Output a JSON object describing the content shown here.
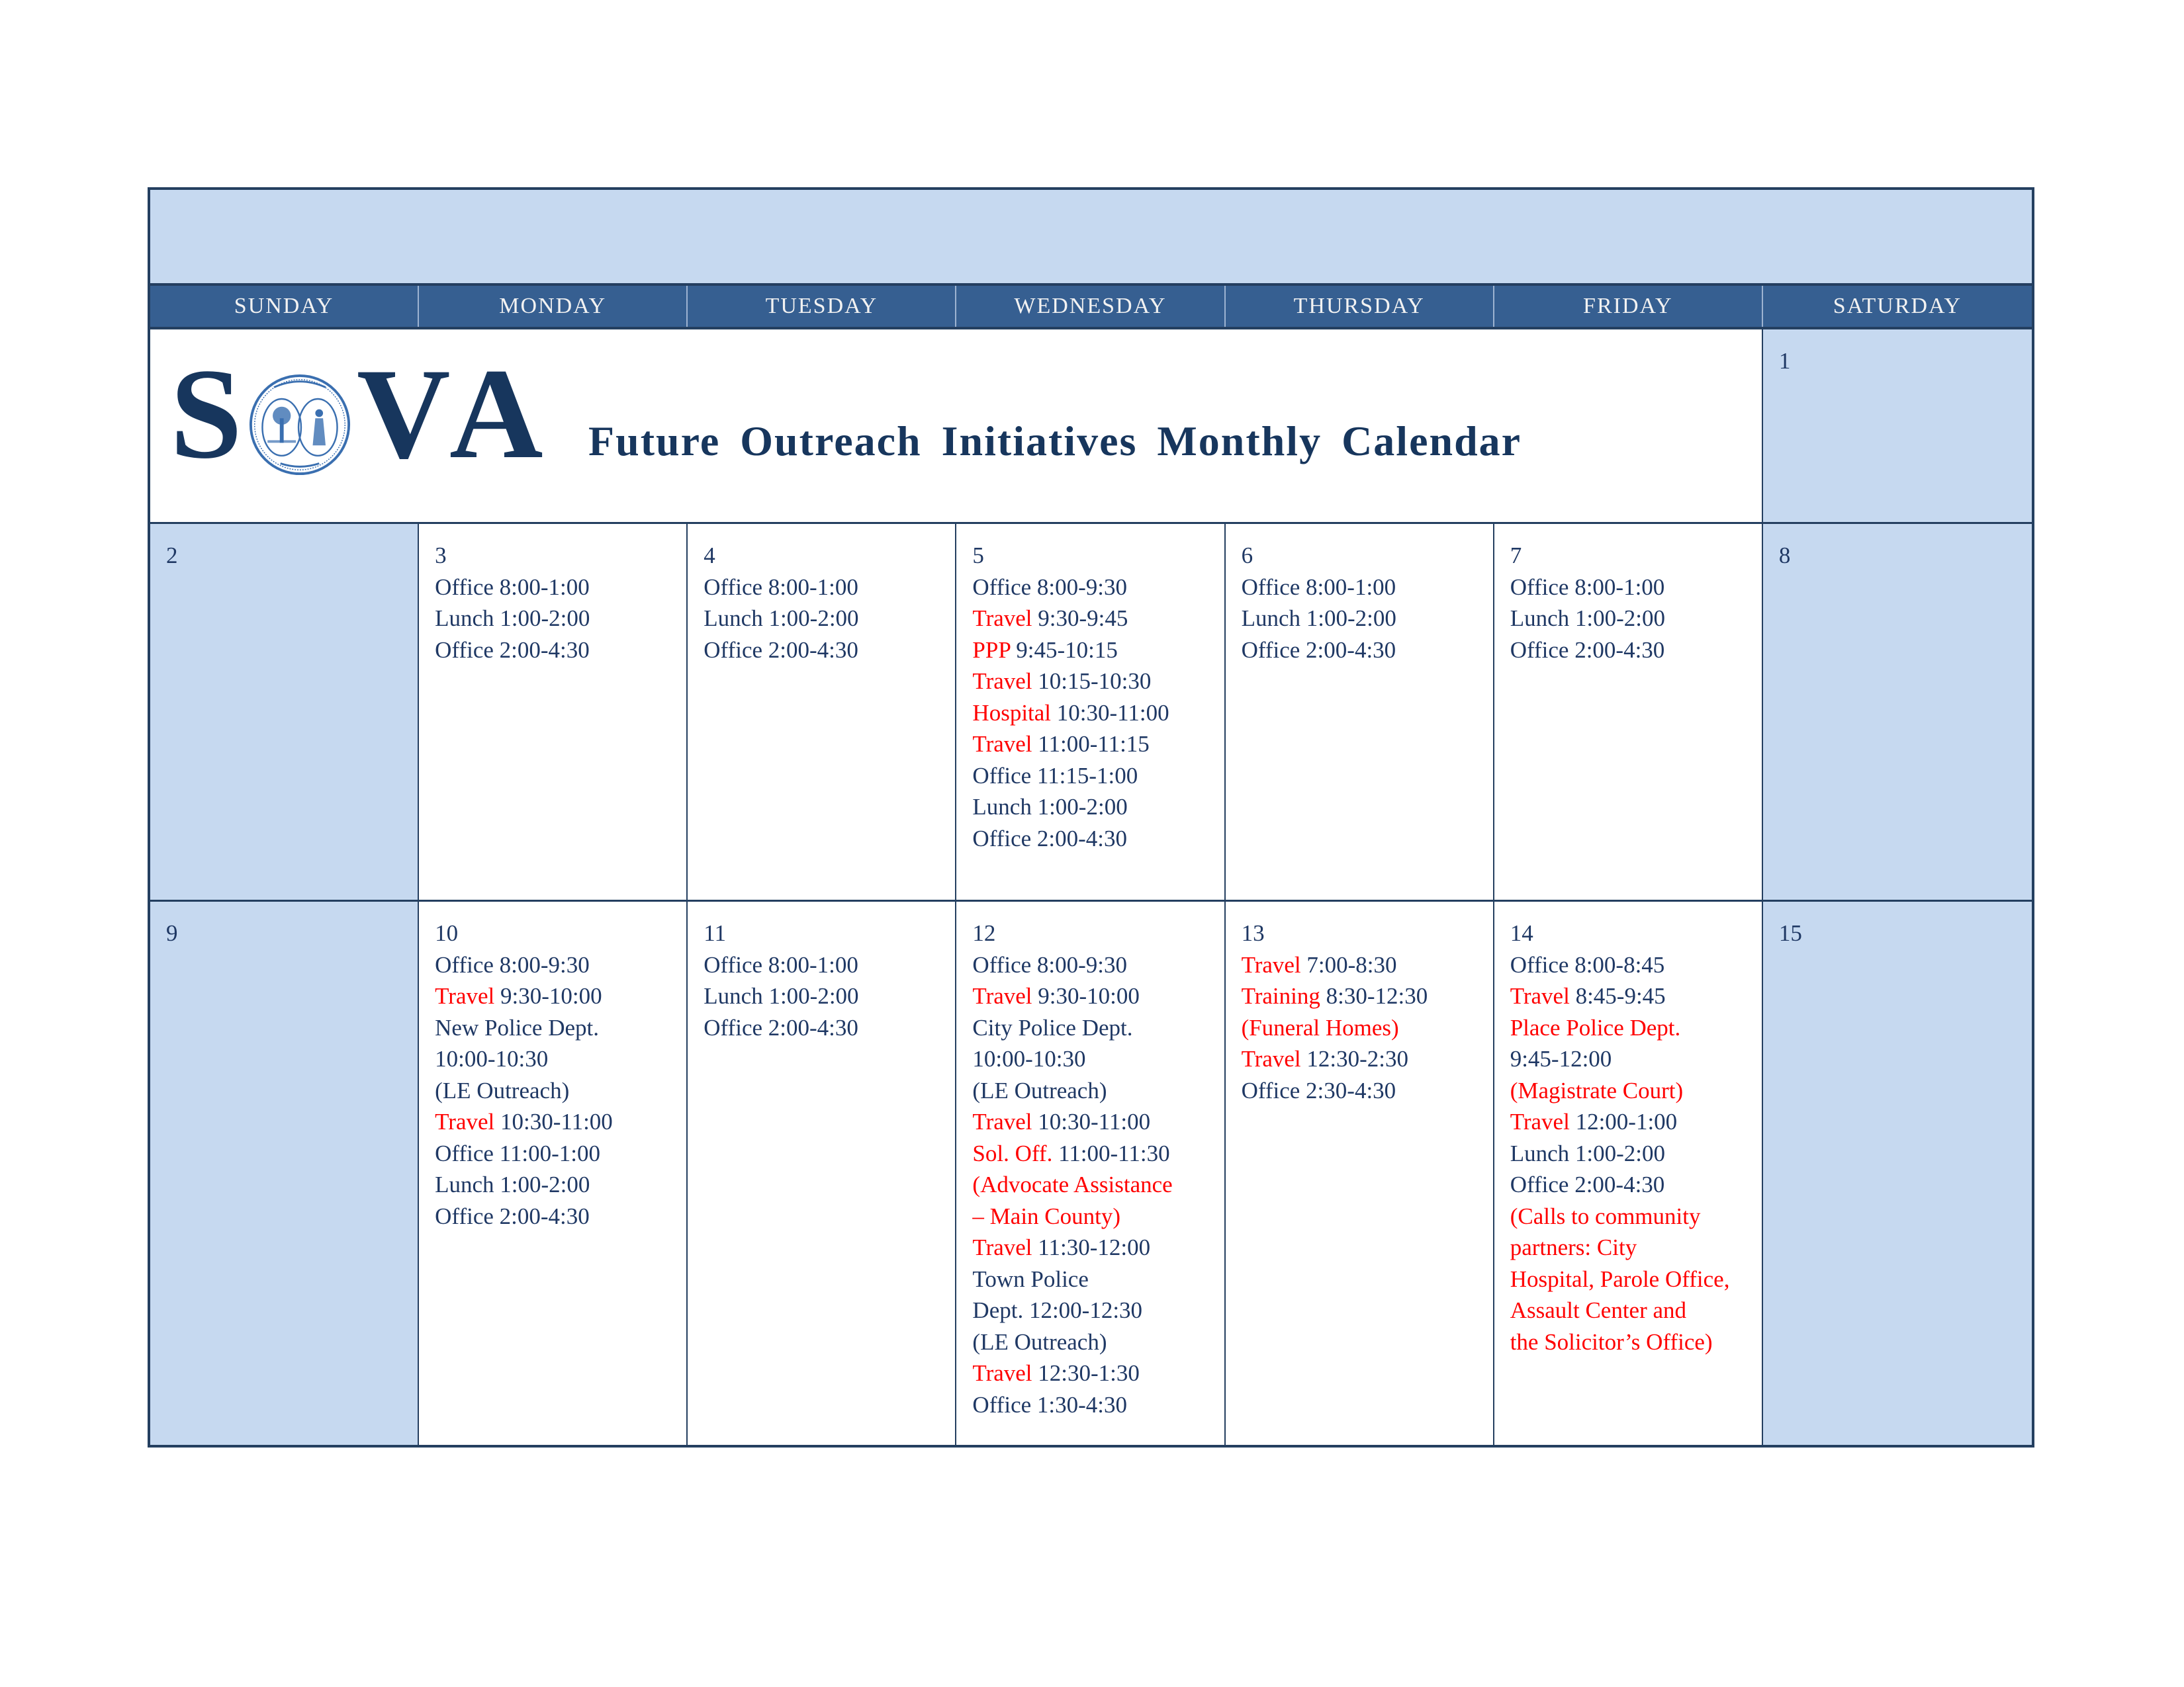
{
  "header": {
    "logo_letters": [
      "S",
      "V",
      "A"
    ],
    "seal_icon": "south-carolina-state-seal",
    "title": "Future Outreach Initiatives Monthly Calendar"
  },
  "weekdays": [
    "SUNDAY",
    "MONDAY",
    "TUESDAY",
    "WEDNESDAY",
    "THURSDAY",
    "FRIDAY",
    "SATURDAY"
  ],
  "colors": {
    "text": "#1f3864",
    "highlight": "#ff0000",
    "weekend_fill": "#c6d9f0",
    "header_fill": "#365f91"
  },
  "weeks": [
    {
      "days": [
        {
          "num": "1",
          "entries": []
        }
      ]
    },
    {
      "days": [
        {
          "num": "2",
          "entries": []
        },
        {
          "num": "3",
          "entries": [
            [
              {
                "t": "Office 8:00-1:00"
              }
            ],
            [
              {
                "t": "Lunch 1:00-2:00"
              }
            ],
            [
              {
                "t": "Office 2:00-4:30"
              }
            ]
          ]
        },
        {
          "num": "4",
          "entries": [
            [
              {
                "t": "Office 8:00-1:00"
              }
            ],
            [
              {
                "t": "Lunch 1:00-2:00"
              }
            ],
            [
              {
                "t": "Office 2:00-4:30"
              }
            ]
          ]
        },
        {
          "num": "5",
          "entries": [
            [
              {
                "t": "Office 8:00-9:30"
              }
            ],
            [
              {
                "t": "Travel",
                "r": true
              },
              {
                "t": " 9:30-9:45"
              }
            ],
            [
              {
                "t": "PPP",
                "r": true
              },
              {
                "t": " 9:45-10:15"
              }
            ],
            [
              {
                "t": "Travel",
                "r": true
              },
              {
                "t": " 10:15-10:30"
              }
            ],
            [
              {
                "t": "Hospital",
                "r": true
              },
              {
                "t": " 10:30-11:00"
              }
            ],
            [
              {
                "t": "Travel",
                "r": true
              },
              {
                "t": " 11:00-11:15"
              }
            ],
            [
              {
                "t": "Office 11:15-1:00"
              }
            ],
            [
              {
                "t": "Lunch 1:00-2:00"
              }
            ],
            [
              {
                "t": "Office 2:00-4:30"
              }
            ]
          ]
        },
        {
          "num": "6",
          "entries": [
            [
              {
                "t": "Office 8:00-1:00"
              }
            ],
            [
              {
                "t": "Lunch 1:00-2:00"
              }
            ],
            [
              {
                "t": "Office 2:00-4:30"
              }
            ]
          ]
        },
        {
          "num": "7",
          "entries": [
            [
              {
                "t": "Office 8:00-1:00"
              }
            ],
            [
              {
                "t": "Lunch 1:00-2:00"
              }
            ],
            [
              {
                "t": "Office 2:00-4:30"
              }
            ]
          ]
        },
        {
          "num": "8",
          "entries": []
        }
      ]
    },
    {
      "days": [
        {
          "num": "9",
          "entries": []
        },
        {
          "num": "10",
          "entries": [
            [
              {
                "t": "Office 8:00-9:30"
              }
            ],
            [
              {
                "t": "Travel",
                "r": true
              },
              {
                "t": " 9:30-10:00"
              }
            ],
            [
              {
                "t": "New Police Dept."
              }
            ],
            [
              {
                "t": "10:00-10:30"
              }
            ],
            [
              {
                "t": "(LE Outreach)"
              }
            ],
            [
              {
                "t": "Travel",
                "r": true
              },
              {
                "t": " 10:30-11:00"
              }
            ],
            [
              {
                "t": "Office 11:00-1:00"
              }
            ],
            [
              {
                "t": "Lunch 1:00-2:00"
              }
            ],
            [
              {
                "t": "Office 2:00-4:30"
              }
            ]
          ]
        },
        {
          "num": "11",
          "entries": [
            [
              {
                "t": "Office 8:00-1:00"
              }
            ],
            [
              {
                "t": "Lunch 1:00-2:00"
              }
            ],
            [
              {
                "t": "Office 2:00-4:30"
              }
            ]
          ]
        },
        {
          "num": "12",
          "entries": [
            [
              {
                "t": "Office 8:00-9:30"
              }
            ],
            [
              {
                "t": "Travel",
                "r": true
              },
              {
                "t": " 9:30-10:00"
              }
            ],
            [
              {
                "t": "City Police Dept."
              }
            ],
            [
              {
                "t": "10:00-10:30"
              }
            ],
            [
              {
                "t": "(LE Outreach)"
              }
            ],
            [
              {
                "t": "Travel",
                "r": true
              },
              {
                "t": " 10:30-11:00"
              }
            ],
            [
              {
                "t": "Sol. Off.",
                "r": true
              },
              {
                "t": " 11:00-11:30"
              }
            ],
            [
              {
                "t": "(Advocate Assistance",
                "r": true
              }
            ],
            [
              {
                "t": "– Main County)",
                "r": true
              }
            ],
            [
              {
                "t": "Travel",
                "r": true
              },
              {
                "t": " 11:30-12:00"
              }
            ],
            [
              {
                "t": "Town Police"
              }
            ],
            [
              {
                "t": "Dept. 12:00-12:30"
              }
            ],
            [
              {
                "t": "(LE Outreach)"
              }
            ],
            [
              {
                "t": "Travel",
                "r": true
              },
              {
                "t": " 12:30-1:30"
              }
            ],
            [
              {
                "t": "Office 1:30-4:30"
              }
            ]
          ]
        },
        {
          "num": "13",
          "entries": [
            [
              {
                "t": "Travel",
                "r": true
              },
              {
                "t": " 7:00-8:30"
              }
            ],
            [
              {
                "t": "Training",
                "r": true
              },
              {
                "t": " 8:30-12:30"
              }
            ],
            [
              {
                "t": "(Funeral Homes)",
                "r": true
              }
            ],
            [
              {
                "t": "Travel",
                "r": true
              },
              {
                "t": " 12:30-2:30"
              }
            ],
            [
              {
                "t": "Office 2:30-4:30"
              }
            ]
          ]
        },
        {
          "num": "14",
          "entries": [
            [
              {
                "t": "Office 8:00-8:45"
              }
            ],
            [
              {
                "t": "Travel",
                "r": true
              },
              {
                "t": " 8:45-9:45"
              }
            ],
            [
              {
                "t": "Place Police Dept.",
                "r": true
              }
            ],
            [
              {
                "t": "9:45-12:00"
              }
            ],
            [
              {
                "t": "(Magistrate Court)",
                "r": true
              }
            ],
            [
              {
                "t": "Travel",
                "r": true
              },
              {
                "t": " 12:00-1:00"
              }
            ],
            [
              {
                "t": "Lunch 1:00-2:00"
              }
            ],
            [
              {
                "t": "Office 2:00-4:30"
              }
            ],
            [
              {
                "t": "(Calls to community",
                "r": true
              }
            ],
            [
              {
                "t": "partners: City",
                "r": true
              }
            ],
            [
              {
                "t": "Hospital, Parole Office,",
                "r": true
              }
            ],
            [
              {
                "t": "Assault Center and",
                "r": true
              }
            ],
            [
              {
                "t": "the Solicitor’s Office)",
                "r": true
              }
            ]
          ]
        },
        {
          "num": "15",
          "entries": []
        }
      ]
    }
  ]
}
